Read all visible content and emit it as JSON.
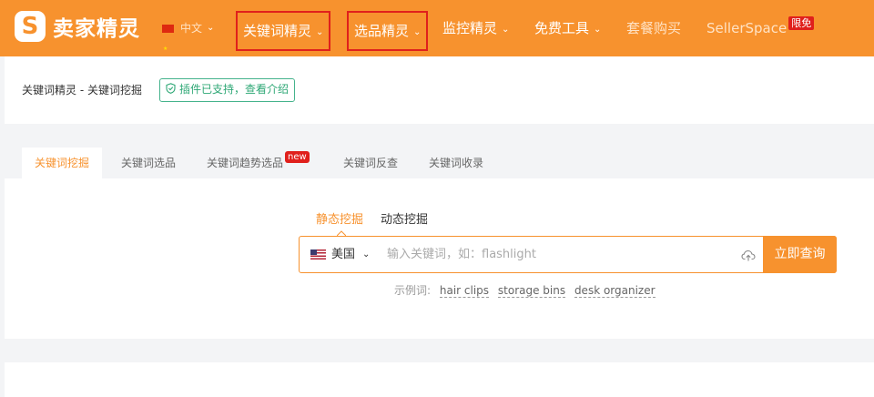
{
  "brand": {
    "name": "卖家精灵",
    "mark": "S"
  },
  "nav": {
    "language": "中文",
    "items": [
      {
        "label": "关键词精灵",
        "has_dropdown": true
      },
      {
        "label": "选品精灵",
        "has_dropdown": true
      },
      {
        "label": "监控精灵",
        "has_dropdown": true
      },
      {
        "label": "免费工具",
        "has_dropdown": true
      },
      {
        "label": "套餐购买",
        "has_dropdown": false
      },
      {
        "label": "SellerSpace",
        "has_dropdown": false,
        "badge": "限免"
      }
    ]
  },
  "breadcrumb": {
    "text": "关键词精灵 - 关键词挖掘",
    "plugin_tag": "插件已支持，查看介绍"
  },
  "tabs": [
    {
      "label": "关键词挖掘",
      "active": true
    },
    {
      "label": "关键词选品"
    },
    {
      "label": "关键词趋势选品",
      "badge": "new"
    },
    {
      "label": "关键词反查"
    },
    {
      "label": "关键词收录"
    }
  ],
  "modes": {
    "static": "静态挖掘",
    "dynamic": "动态挖掘"
  },
  "search": {
    "country": "美国",
    "placeholder": "输入关键词，如：flashlight",
    "value": "",
    "button": "立即查询"
  },
  "examples": {
    "label": "示例词:",
    "words": [
      "hair clips",
      "storage bins",
      "desk organizer"
    ]
  },
  "colors": {
    "brand": "#f7922e",
    "highlight": "#e0201c",
    "plugin": "#2fa876"
  }
}
